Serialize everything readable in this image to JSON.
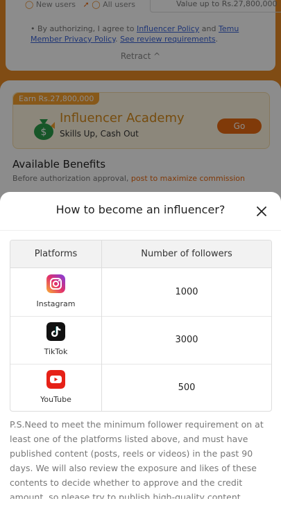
{
  "background": {
    "top_items": {
      "new_users": "New users",
      "all_users": "All users",
      "value_text": "Value up to Rs.27,800,000"
    },
    "auth": {
      "prefix": "By authorizing, I agree to ",
      "policy_link": "Influencer Policy",
      "and": " and ",
      "privacy_link": "Temu Member Privacy Policy",
      "sep": ". ",
      "review_link": "See review requirements",
      "end": "."
    },
    "retract_label": "Retract ^",
    "earn_badge": "Earn Rs.27,800,000",
    "academy": {
      "title": "Influencer Academy",
      "subtitle": "Skills Up, Cash Out",
      "go_label": "Go"
    },
    "benefits": {
      "title": "Available Benefits",
      "note_prefix": "Before authorization approval, ",
      "note_highlight": "post to maximize commission"
    }
  },
  "sheet": {
    "title": "How to become an influencer?",
    "close_icon": "close-icon",
    "table": {
      "headers": [
        "Platforms",
        "Number of followers"
      ],
      "rows": [
        {
          "platform": "Instagram",
          "icon": "instagram-icon",
          "followers": "1000"
        },
        {
          "platform": "TikTok",
          "icon": "tiktok-icon",
          "followers": "3000"
        },
        {
          "platform": "YouTube",
          "icon": "youtube-icon",
          "followers": "500"
        }
      ]
    },
    "ps_text": "P.S.Need to meet the minimum follower requirement on at least one of the platforms listed above, and must have published content (posts, reels or videos) in the past 90 days. We will also review the exposure and likes of these contents to decide whether to approve and the credit amount, so please try to publish high-quality content."
  },
  "colors": {
    "accent_orange": "#ea6a12",
    "academy_title": "#d88a1a",
    "link_blue": "#3a63d8",
    "youtube_red": "#e62117",
    "tiktok_black": "#111111"
  }
}
